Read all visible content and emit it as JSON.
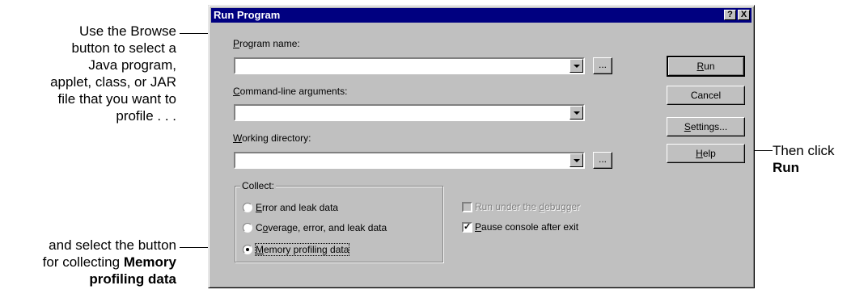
{
  "callouts": {
    "browse": [
      "Use the Browse",
      "button to select a",
      "Java program,",
      "applet, class, or JAR",
      "file that you want to",
      "profile . . ."
    ],
    "select_prefix": [
      "and select the button",
      "for collecting "
    ],
    "select_bold_1": "Memory",
    "select_bold_2": "profiling data",
    "then_click": "Then click",
    "run_bold": "Run"
  },
  "dialog": {
    "title": "Run Program",
    "help_btn": "?",
    "close_btn": "X",
    "program_name": {
      "label_u": "P",
      "label_rest": "rogram name:",
      "value": ""
    },
    "command_line": {
      "label_u": "C",
      "label_rest": "ommand-line arguments:",
      "value": ""
    },
    "working_dir": {
      "label_u": "W",
      "label_rest": "orking directory:",
      "value": ""
    },
    "browse_label": "...",
    "buttons": {
      "run_u": "R",
      "run_rest": "un",
      "cancel": "Cancel",
      "settings_u": "S",
      "settings_rest": "ettings...",
      "help_u": "H",
      "help_rest": "elp"
    },
    "collect": {
      "legend": "Collect:",
      "options": [
        {
          "u": "E",
          "rest": "rror and leak data",
          "selected": false
        },
        {
          "pre": "C",
          "u": "o",
          "rest": "verage, error, and leak data",
          "selected": false
        },
        {
          "u": "M",
          "rest": "emory profiling data",
          "selected": true
        }
      ]
    },
    "debugger": {
      "pre": "Run under the ",
      "u": "d",
      "rest": "ebugger",
      "checked": false,
      "enabled": false
    },
    "pause": {
      "u": "P",
      "rest": "ause console after exit",
      "checked": true
    }
  }
}
